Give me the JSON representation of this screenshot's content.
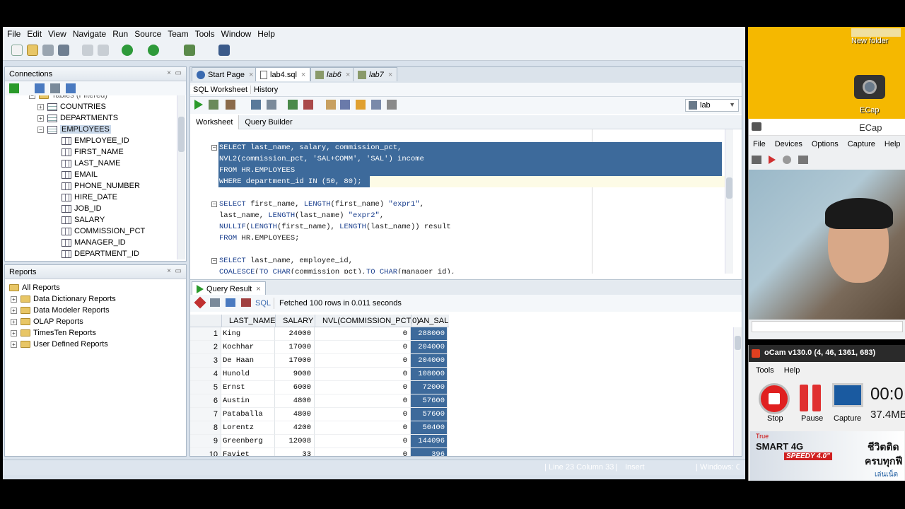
{
  "menu": [
    "File",
    "Edit",
    "View",
    "Navigate",
    "Run",
    "Source",
    "Team",
    "Tools",
    "Window",
    "Help"
  ],
  "connections": {
    "title": "Connections",
    "items": [
      {
        "label": "COUNTRIES",
        "kind": "table",
        "indent": 1
      },
      {
        "label": "DEPARTMENTS",
        "kind": "table",
        "indent": 1
      },
      {
        "label": "EMPLOYEES",
        "kind": "table",
        "indent": 1,
        "selected": true
      },
      {
        "label": "EMPLOYEE_ID",
        "kind": "column",
        "indent": 2
      },
      {
        "label": "FIRST_NAME",
        "kind": "column",
        "indent": 2
      },
      {
        "label": "LAST_NAME",
        "kind": "column",
        "indent": 2
      },
      {
        "label": "EMAIL",
        "kind": "column",
        "indent": 2
      },
      {
        "label": "PHONE_NUMBER",
        "kind": "column",
        "indent": 2
      },
      {
        "label": "HIRE_DATE",
        "kind": "column",
        "indent": 2
      },
      {
        "label": "JOB_ID",
        "kind": "column",
        "indent": 2
      },
      {
        "label": "SALARY",
        "kind": "column",
        "indent": 2
      },
      {
        "label": "COMMISSION_PCT",
        "kind": "column",
        "indent": 2
      },
      {
        "label": "MANAGER_ID",
        "kind": "column",
        "indent": 2
      },
      {
        "label": "DEPARTMENT_ID",
        "kind": "column",
        "indent": 2
      }
    ]
  },
  "reports": {
    "title": "Reports",
    "items": [
      "All Reports",
      "Data Dictionary Reports",
      "Data Modeler Reports",
      "OLAP Reports",
      "TimesTen Reports",
      "User Defined Reports"
    ]
  },
  "editor_tabs": [
    "Start Page",
    "lab4.sql",
    "lab6",
    "lab7"
  ],
  "subtabs": [
    "SQL Worksheet",
    "History"
  ],
  "worksheet_tabs": [
    "Worksheet",
    "Query Builder"
  ],
  "connection_select": "lab",
  "code_lines": [
    "SELECT last_name, salary, commission_pct,",
    "NVL2(commission_pct, 'SAL+COMM', 'SAL') income",
    "FROM HR.EMPLOYEES",
    "WHERE department_id IN (50, 80);",
    "",
    "SELECT first_name, LENGTH(first_name) \"expr1\",",
    "last_name, LENGTH(last_name) \"expr2\",",
    "NULLIF(LENGTH(first_name), LENGTH(last_name)) result",
    "FROM HR.EMPLOYEES;",
    "",
    "SELECT last_name, employee_id,",
    "COALESCE(TO_CHAR(commission_pct),TO_CHAR(manager_id),"
  ],
  "result": {
    "tab": "Query Result",
    "sql_label": "SQL",
    "fetch_msg": "Fetched 100 rows in 0.011 seconds",
    "columns": [
      "LAST_NAME",
      "SALARY",
      "NVL(COMMISSION_PCT,0)",
      "AN_SAL"
    ],
    "rows": [
      [
        "1",
        "King",
        "24000",
        "0",
        "288000"
      ],
      [
        "2",
        "Kochhar",
        "17000",
        "0",
        "204000"
      ],
      [
        "3",
        "De Haan",
        "17000",
        "0",
        "204000"
      ],
      [
        "4",
        "Hunold",
        "9000",
        "0",
        "108000"
      ],
      [
        "5",
        "Ernst",
        "6000",
        "0",
        "72000"
      ],
      [
        "6",
        "Austin",
        "4800",
        "0",
        "57600"
      ],
      [
        "7",
        "Pataballa",
        "4800",
        "0",
        "57600"
      ],
      [
        "8",
        "Lorentz",
        "4200",
        "0",
        "50400"
      ],
      [
        "9",
        "Greenberg",
        "12008",
        "0",
        "144096"
      ],
      [
        "10",
        "Faviet",
        "33",
        "0",
        "396"
      ]
    ]
  },
  "status": {
    "position": "Line 23 Column 33",
    "mode": "Insert",
    "os": "Windows: CR"
  },
  "desktop": {
    "icons": [
      "New folder",
      "ECap"
    ]
  },
  "ecap": {
    "title": "ECap",
    "menu": [
      "File",
      "Devices",
      "Options",
      "Capture",
      "Help"
    ]
  },
  "ocam": {
    "title": "oCam v130.0 (4, 46, 1361, 683)",
    "menu": [
      "Tools",
      "Help"
    ],
    "buttons": [
      "Stop",
      "Pause",
      "Capture"
    ],
    "timer": "00:0",
    "size": "37.4MB",
    "ad_brand": "True",
    "ad_line1": "SMART 4G",
    "ad_line2": "SPEEDY 4.0\"",
    "ad_thai1": "ชีวิตติด",
    "ad_thai2": "ครบทุกฟี",
    "ad_thai3": "เล่นเน็ต"
  },
  "colors": {
    "selection": "#3d6a9b",
    "ide_bg": "#d9e2ec",
    "desktop": "#f5b800",
    "stop_red": "#e02020"
  }
}
